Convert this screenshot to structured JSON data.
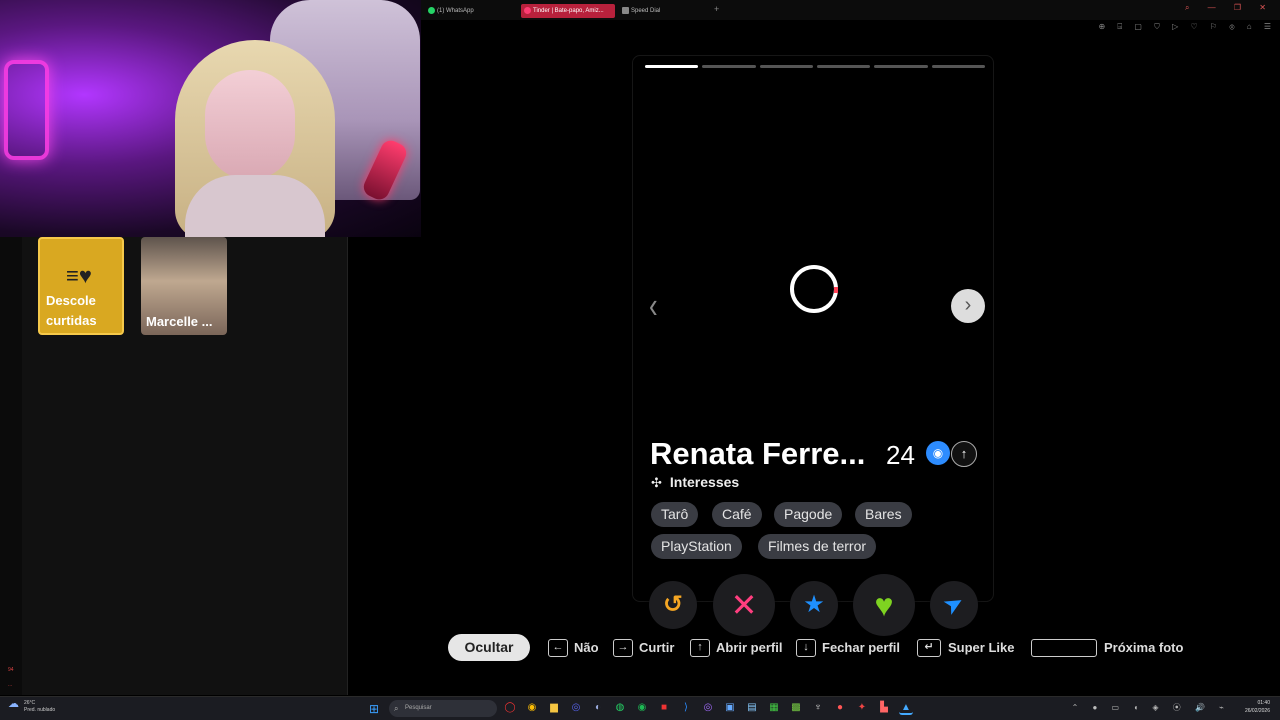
{
  "browser": {
    "tabs": [
      {
        "label": "(1) WhatsApp",
        "active": false,
        "icon": "whatsapp-icon"
      },
      {
        "label": "Tinder | Bate-papo, Amiz...",
        "active": true,
        "icon": "tinder-flame-icon"
      },
      {
        "label": "Speed Dial",
        "active": false,
        "icon": "speed-dial-icon"
      }
    ],
    "new_tab": "+",
    "window_controls": "⌕ — ❐ ✕",
    "toolbar_icons": "⊕ ⍈ ▢ ⛉ ▷ ♡ ⚐ ⦾ ⌂ ☰"
  },
  "sidebar": {
    "likes_card": {
      "label": "Descole curtidas",
      "icon": "double-heart-icon"
    },
    "matches": [
      {
        "name": "Marcelle ..."
      }
    ],
    "strip_marks": [
      "94",
      "..."
    ]
  },
  "profile": {
    "photo_count": 6,
    "current_photo": 1,
    "name": "Renata Ferre...",
    "age": "24",
    "badges": [
      "verified-camera-icon",
      "info-up-icon"
    ],
    "interests_title": "Interesses",
    "interests": [
      "Tarô",
      "Café",
      "Pagode",
      "Bares",
      "PlayStation",
      "Filmes de terror"
    ]
  },
  "actions": {
    "rewind": "↺",
    "nope": "✕",
    "super_like": "★",
    "like": "♥",
    "boost": "➤",
    "colors": {
      "rewind": "#f5a623",
      "nope": "#ff3e7f",
      "super_like": "#1e90ff",
      "like": "#7ed321",
      "boost": "#1e90ff"
    }
  },
  "shortcuts": {
    "hide": "Ocultar",
    "items": [
      {
        "key": "←",
        "label": "Não"
      },
      {
        "key": "→",
        "label": "Curtir"
      },
      {
        "key": "↑",
        "label": "Abrir perfil"
      },
      {
        "key": "↓",
        "label": "Fechar perfil"
      },
      {
        "key": "↵",
        "label": "Super Like"
      },
      {
        "key": "",
        "label": "Próxima foto"
      }
    ]
  },
  "taskbar": {
    "weather_temp": "26°C",
    "weather_desc": "Pred. nublado",
    "search_placeholder": "Pesquisar",
    "time": "01:40",
    "date": "26/02/2026",
    "tray": "⌃ ● ▭ ◖ ◈ ⦿ 🔊 ⌁"
  }
}
